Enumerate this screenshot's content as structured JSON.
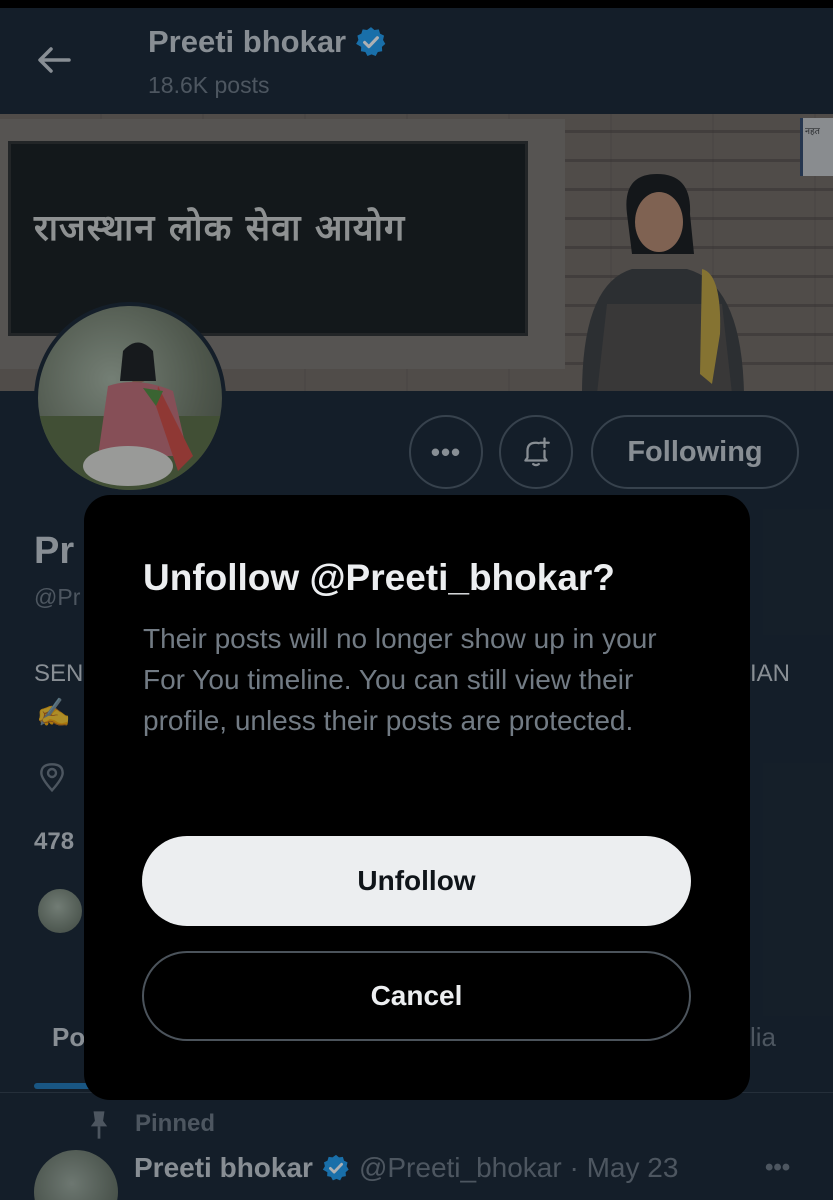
{
  "header": {
    "name": "Preeti bhokar",
    "posts_count": "18.6K posts",
    "icons": {
      "back": "back-arrow-icon",
      "verified": "verified-badge-icon"
    }
  },
  "banner": {
    "sign_text": "राजस्थान लोक सेवा आयोग",
    "plaque_text": "नहत"
  },
  "profile_actions": {
    "more_label": "•••",
    "notify_icon": "bell-plus-icon",
    "following_label": "Following"
  },
  "background_profile": {
    "name_fragment": "Pr",
    "handle_fragment": "@Pr",
    "bio_left_fragment": "SEN",
    "bio_right_fragment": "IAN",
    "emoji_fragment": "✍️",
    "count_fragment": "478",
    "tab_posts_fragment": "Po",
    "tab_media_fragment": "lia"
  },
  "pinned_post": {
    "pinned_label": "Pinned",
    "name": "Preeti bhokar",
    "handle_date": "@Preeti_bhokar · May 23",
    "more_label": "•••"
  },
  "dialog": {
    "title": "Unfollow @Preeti_bhokar?",
    "body": "Their posts will no longer show up in your For You timeline. You can still view their profile, unless their posts are protected.",
    "confirm_label": "Unfollow",
    "cancel_label": "Cancel"
  },
  "colors": {
    "background": "#15202b",
    "verified_blue": "#1d9bf0",
    "dialog_bg": "#000000",
    "primary_button_bg": "#eceef0"
  }
}
